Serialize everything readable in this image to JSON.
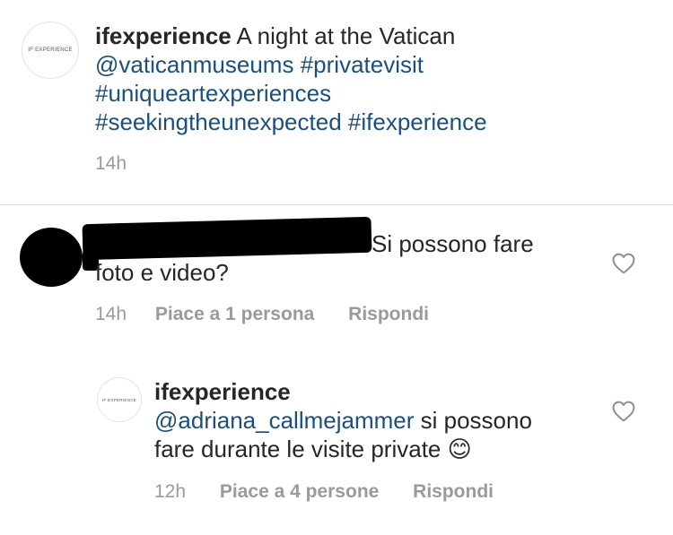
{
  "post": {
    "avatar_text": "IF EXPERIENCE",
    "username": "ifexperience",
    "text": "A night at the Vatican",
    "tags_line1": [
      "@vaticanmuseums",
      "#privatevisit"
    ],
    "tags_line2": [
      "#uniqueartexperiences"
    ],
    "tags_line3": [
      "#seekingtheunexpected",
      "#ifexperience"
    ],
    "time": "14h"
  },
  "comment": {
    "text_line1": "Si possono fare",
    "text_line2": "foto e video?",
    "time": "14h",
    "likes": "Piace a 1 persona",
    "reply": "Rispondi"
  },
  "reply": {
    "avatar_text": "IF EXPERIENCE",
    "username": "ifexperience",
    "mention": "@adriana_callmejammer",
    "text_line1": "si possono",
    "text_line2": "fare durante le visite private",
    "emoji": "😊",
    "time": "12h",
    "likes": "Piace a 4 persone",
    "reply": "Rispondi"
  },
  "colors": {
    "link": "#1c4f7a",
    "meta": "#9a9a9a",
    "text": "#262626"
  },
  "icons": [
    "heart-icon"
  ]
}
